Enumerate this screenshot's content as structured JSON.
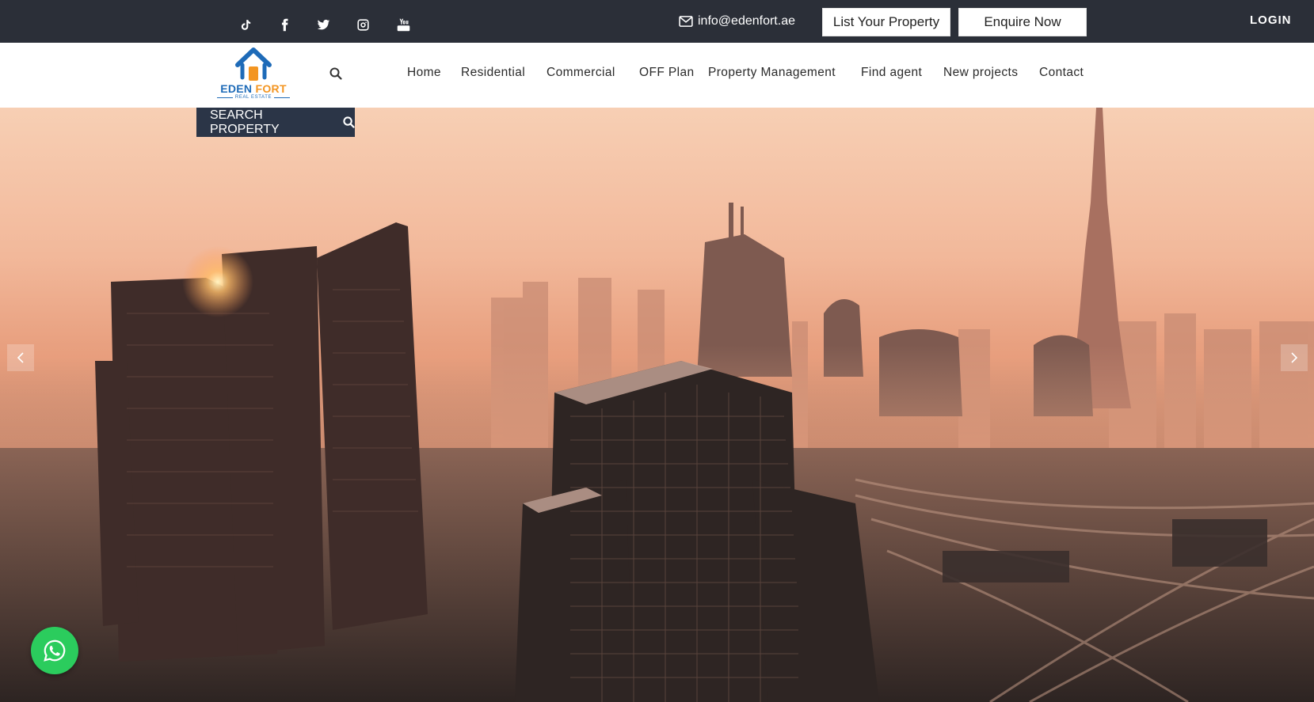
{
  "topbar": {
    "social": [
      {
        "name": "tiktok-icon"
      },
      {
        "name": "facebook-icon"
      },
      {
        "name": "twitter-icon"
      },
      {
        "name": "instagram-icon"
      },
      {
        "name": "youtube-icon"
      }
    ],
    "email": "info@edenfort.ae",
    "list_property_label": "List Your Property",
    "enquire_label": "Enquire Now",
    "login_label": "LOGIN"
  },
  "logo": {
    "word1": "EDEN",
    "word2": "FORT",
    "subtitle": "REAL ESTATE"
  },
  "nav": {
    "items": [
      "Home",
      "Residential",
      "Commercial",
      "OFF Plan",
      "Property Management",
      "Find agent",
      "New projects",
      "Contact"
    ]
  },
  "hero": {
    "search_label": "SEARCH PROPERTY",
    "prev_icon": "chevron-left-icon",
    "next_icon": "chevron-right-icon"
  },
  "colors": {
    "topbar_bg": "#2b2f38",
    "search_bg": "#2b3547",
    "brand_blue": "#1e6bb8",
    "brand_orange": "#f39521",
    "whatsapp": "#2bcc5d"
  }
}
